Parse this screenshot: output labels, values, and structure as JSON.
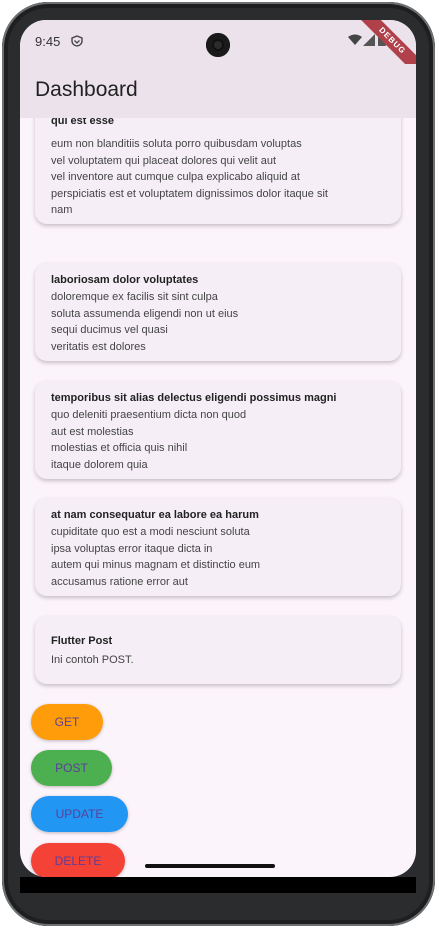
{
  "status": {
    "time": "9:45",
    "debug": "DEBUG"
  },
  "appbar": {
    "title": "Dashboard"
  },
  "cards": [
    {
      "title": "qui est esse",
      "body": "eum non blanditiis soluta porro quibusdam voluptas\nvel voluptatem qui placeat dolores qui velit aut\nvel inventore aut cumque culpa explicabo aliquid at\nperspiciatis est et voluptatem dignissimos dolor itaque sit\nnam"
    },
    {
      "title": "laboriosam dolor voluptates",
      "body": "doloremque ex facilis sit sint culpa\nsoluta assumenda eligendi non ut eius\nsequi ducimus vel quasi\nveritatis est dolores"
    },
    {
      "title": "temporibus sit alias delectus eligendi possimus magni",
      "body": "quo deleniti praesentium dicta non quod\naut est molestias\nmolestias et officia quis nihil\nitaque dolorem quia"
    },
    {
      "title": "at nam consequatur ea labore ea harum",
      "body": "cupiditate quo est a modi nesciunt soluta\nipsa voluptas error itaque dicta in\nautem qui minus magnam et distinctio eum\naccusamus ratione error aut"
    },
    {
      "title": "Flutter Post",
      "body": "Ini contoh POST."
    }
  ],
  "buttons": {
    "get": {
      "label": "GET",
      "color": "#ff9c0a"
    },
    "post": {
      "label": "POST",
      "color": "#4caf50"
    },
    "update": {
      "label": "UPDATE",
      "color": "#2196f3"
    },
    "delete": {
      "label": "DELETE",
      "color": "#f44336"
    }
  }
}
